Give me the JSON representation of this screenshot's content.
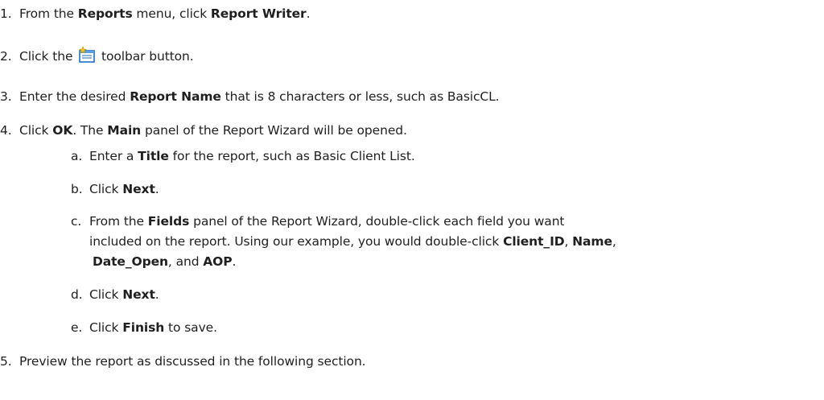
{
  "steps": {
    "s1": {
      "num": "1.",
      "t1": "From the ",
      "b1": "Reports",
      "t2": " menu, click ",
      "b2": "Report Writer",
      "t3": "."
    },
    "s2": {
      "num": "2.",
      "t1": "Click the ",
      "t2": " toolbar button.",
      "icon": "new-report-wizard-icon"
    },
    "s3": {
      "num": "3.",
      "t1": "Enter the desired ",
      "b1": "Report Name",
      "t2": " that is 8 characters or less, such as BasicCL."
    },
    "s4": {
      "num": "4.",
      "t1": "Click ",
      "b1": "OK",
      "t2": ". The ",
      "b2": "Main",
      "t3": " panel of the Report Wizard will be opened."
    },
    "s4a": {
      "marker": "a.",
      "t1": "Enter a ",
      "b1": "Title",
      "t2": " for the report, such as Basic Client List."
    },
    "s4b": {
      "marker": "b.",
      "t1": "Click ",
      "b1": "Next",
      "t2": "."
    },
    "s4c": {
      "marker": "c.",
      "t1": "From the ",
      "b1": "Fields",
      "t2": " panel of the Report Wizard, double-click each field you want",
      "t3": "included on the report. Using our example, you would double-click ",
      "b2": "Client_ID",
      "t4": ", ",
      "b3": "Name",
      "t5": ",",
      "b4": "Date_Open",
      "t6": ", and ",
      "b5": "AOP",
      "t7": "."
    },
    "s4d": {
      "marker": "d.",
      "t1": "Click ",
      "b1": "Next",
      "t2": "."
    },
    "s4e": {
      "marker": "e.",
      "t1": "Click ",
      "b1": "Finish",
      "t2": " to save."
    },
    "s5": {
      "num": "5.",
      "t1": "Preview the report as discussed in the following section."
    }
  }
}
